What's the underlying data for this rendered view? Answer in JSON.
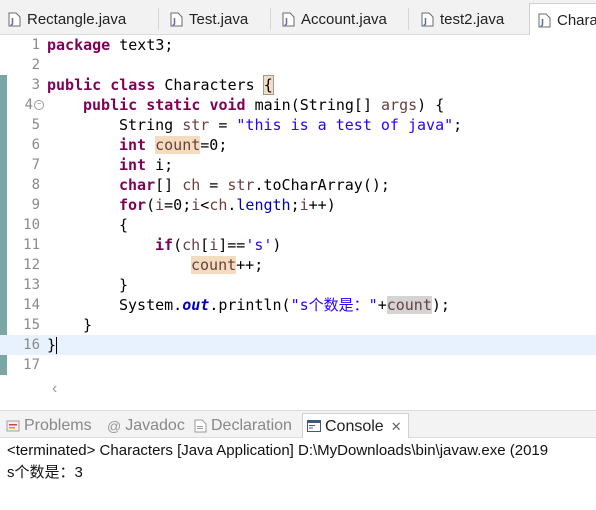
{
  "editor_tabs": [
    {
      "label": "Rectangle.java"
    },
    {
      "label": "Test.java"
    },
    {
      "label": "Account.java"
    },
    {
      "label": "test2.java"
    },
    {
      "label": "Chara"
    }
  ],
  "code": {
    "line_numbers": [
      "1",
      "2",
      "3",
      "4",
      "5",
      "6",
      "7",
      "8",
      "9",
      "10",
      "11",
      "12",
      "13",
      "14",
      "15",
      "16",
      "17"
    ],
    "l1_kw": "package",
    "l1_rest": " text3;",
    "l3_kw1": "public",
    "l3_kw2": "class",
    "l3_rest": " Characters ",
    "l3_brace": "{",
    "l4_kw1": "public",
    "l4_kw2": "static",
    "l4_kw3": "void",
    "l4_rest1": " main(String[] ",
    "l4_param": "args",
    "l4_rest2": ") {",
    "l5_type": "String ",
    "l5_var": "str",
    "l5_eq": " = ",
    "l5_str": "\"this is a test of java\"",
    "l5_end": ";",
    "l6_kw": "int",
    "l6_sp": " ",
    "l6_var": "count",
    "l6_rest": "=0;",
    "l7_kw": "int",
    "l7_rest": " i;",
    "l8_kw": "char",
    "l8_rest1": "[] ",
    "l8_var": "ch",
    "l8_rest2": " = ",
    "l8_var2": "str",
    "l8_rest3": ".toCharArray();",
    "l9_kw": "for",
    "l9_p1": "(",
    "l9_i1": "i",
    "l9_p2": "=0;",
    "l9_i2": "i",
    "l9_p3": "<",
    "l9_ch": "ch",
    "l9_p4": ".",
    "l9_len": "length",
    "l9_p5": ";",
    "l9_i3": "i",
    "l9_p6": "++)",
    "l10": "{",
    "l11_kw": "if",
    "l11_p1": "(",
    "l11_ch": "ch",
    "l11_p2": "[",
    "l11_i": "i",
    "l11_p3": "]==",
    "l11_chr": "'s'",
    "l11_p4": ")",
    "l12_var": "count",
    "l12_rest": "++;",
    "l13": "}",
    "l14_a": "System.",
    "l14_out": "out",
    "l14_b": ".println(",
    "l14_str": "\"s个数是：\"",
    "l14_c": "+",
    "l14_var": "count",
    "l14_d": ");",
    "l15": "}",
    "l16": "}"
  },
  "views_tabs": {
    "problems": "Problems",
    "javadoc": "Javadoc",
    "declaration": "Declaration",
    "console": "Console"
  },
  "console": {
    "header": "<terminated> Characters [Java Application] D:\\MyDownloads\\bin\\javaw.exe (2019",
    "output": "s个数是：3"
  }
}
